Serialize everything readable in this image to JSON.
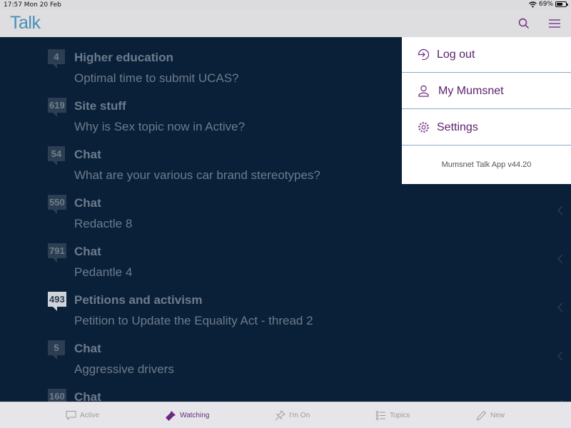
{
  "status_bar": {
    "time_date": "17:57  Mon 20 Feb",
    "battery": "69%",
    "battery_level": 0.69
  },
  "header": {
    "logo": "Talk",
    "search_icon": "search-icon",
    "menu_icon": "hamburger-menu-icon"
  },
  "threads": [
    {
      "count": "4",
      "topic": "Higher education",
      "title": "Optimal time to submit UCAS?"
    },
    {
      "count": "619",
      "topic": "Site stuff",
      "title": "Why is Sex topic now in Active?"
    },
    {
      "count": "54",
      "topic": "Chat",
      "title": "What are your various car brand stereotypes?"
    },
    {
      "count": "550",
      "topic": "Chat",
      "title": "Redactle 8"
    },
    {
      "count": "791",
      "topic": "Chat",
      "title": "Pedantle 4"
    },
    {
      "count": "493",
      "topic": "Petitions and activism",
      "title": "Petition to Update the Equality Act - thread 2",
      "highlight": true
    },
    {
      "count": "5",
      "topic": "Chat",
      "title": "Aggressive drivers"
    },
    {
      "count": "160",
      "topic": "Chat",
      "title": ""
    }
  ],
  "menu": {
    "items": [
      {
        "label": "Log out",
        "icon": "log-out-icon"
      },
      {
        "label": "My Mumsnet",
        "icon": "person-icon"
      },
      {
        "label": "Settings",
        "icon": "gear-icon"
      }
    ],
    "version": "Mumsnet Talk App v44.20"
  },
  "tabs": [
    {
      "label": "Active",
      "icon": "speech-bubble-icon",
      "active": false
    },
    {
      "label": "Watching",
      "icon": "flashlight-icon",
      "active": true
    },
    {
      "label": "I'm On",
      "icon": "pin-icon",
      "active": false
    },
    {
      "label": "Topics",
      "icon": "list-icon",
      "active": false
    },
    {
      "label": "New",
      "icon": "pencil-icon",
      "active": false
    }
  ],
  "colors": {
    "accent": "#6a2a7f",
    "logo": "#4b8fb6",
    "list_bg": "#0a1f38",
    "divider": "#8aa8c4"
  }
}
